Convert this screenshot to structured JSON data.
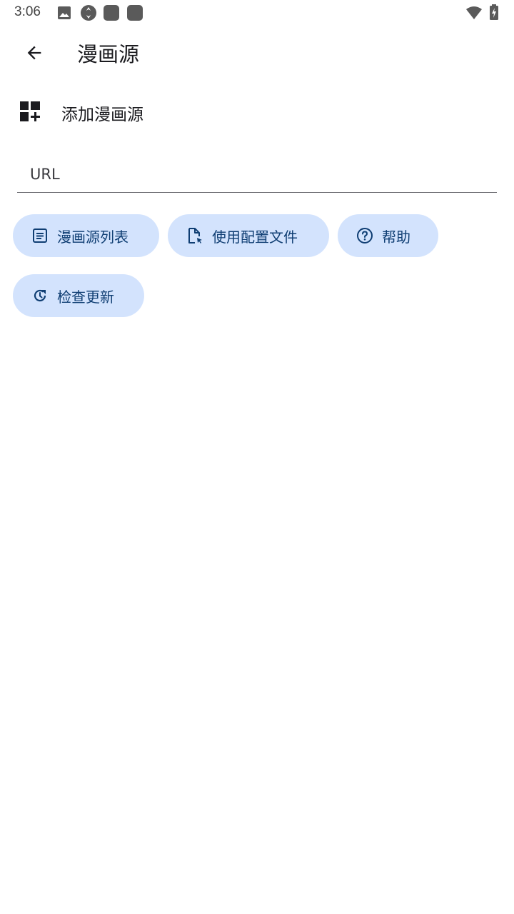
{
  "status_bar": {
    "time": "3:06",
    "icons": [
      "image-icon",
      "sync-icon",
      "app-icon",
      "app-icon",
      "wifi-icon",
      "battery-charging-icon"
    ]
  },
  "app_bar": {
    "back_icon": "arrow-back-icon",
    "title": "漫画源"
  },
  "add_source": {
    "icon": "dashboard-add-icon",
    "label": "添加漫画源"
  },
  "url_field": {
    "value": "",
    "placeholder": "URL"
  },
  "buttons": [
    {
      "label": "漫画源列表",
      "icon": "list-icon"
    },
    {
      "label": "使用配置文件",
      "icon": "file-cursor-icon"
    },
    {
      "label": "帮助",
      "icon": "help-icon"
    },
    {
      "label": "检查更新",
      "icon": "update-icon"
    }
  ],
  "colors": {
    "chip_background": "#d3e3fd",
    "chip_text": "#0f3e73",
    "text_primary": "#1b1b1f"
  }
}
